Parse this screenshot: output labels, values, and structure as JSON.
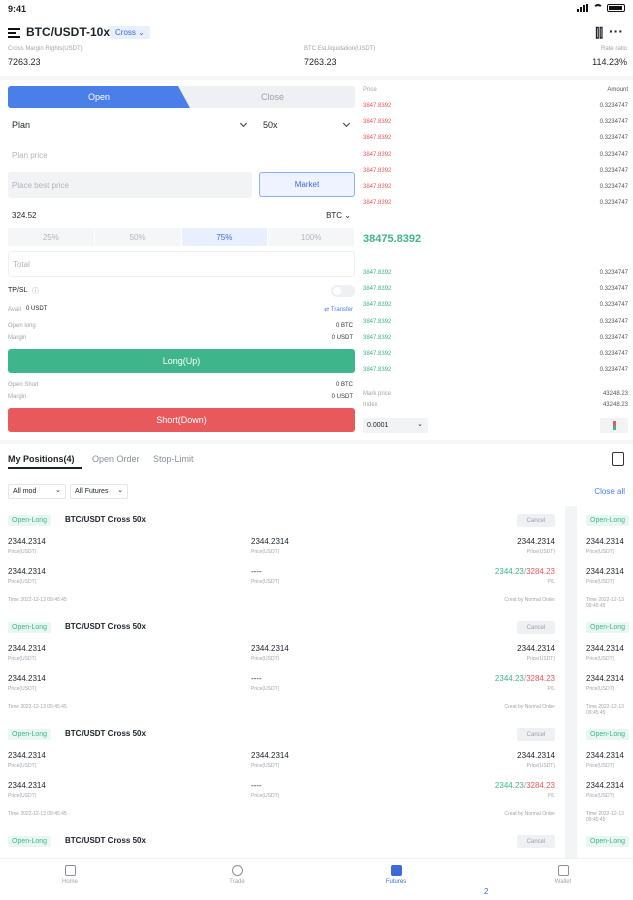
{
  "status": {
    "time": "9:41"
  },
  "header": {
    "pair": "BTC/USDT-10x",
    "mode": "Cross"
  },
  "stats": [
    {
      "label": "Cross Margin Rights(USDT)",
      "value": "7263.23"
    },
    {
      "label": "BTC Est.liquidation(USDT)",
      "value": "7263.23"
    },
    {
      "label": "Rate ratio",
      "value": "114.23%"
    }
  ],
  "form": {
    "tab_open": "Open",
    "tab_close": "Close",
    "order_type": "Plan",
    "leverage": "50x",
    "plan_price_placeholder": "Plan price",
    "best_price_placeholder": "Place best price",
    "market_label": "Market",
    "amount": "324.52",
    "amount_unit": "BTC",
    "percents": [
      "25%",
      "50%",
      "75%",
      "100%"
    ],
    "total_placeholder": "Total",
    "tpsl_label": "TP/SL",
    "avail_label": "Avail",
    "avail_value": "0 USDT",
    "transfer_label": "Transfer",
    "open_long_label": "Open long",
    "open_long_value": "0 BTC",
    "margin_label": "Margin",
    "margin_long_value": "0 USDT",
    "long_button": "Long(Up)",
    "open_short_label": "Open Short",
    "open_short_value": "0 BTC",
    "margin_short_value": "0 USDT",
    "short_button": "Short(Down)"
  },
  "orderbook": {
    "price_header": "Price",
    "amount_header": "Amount",
    "asks": [
      {
        "price": "3847.8392",
        "amount": "0.3234747"
      },
      {
        "price": "3847.8392",
        "amount": "0.3234747"
      },
      {
        "price": "3847.8392",
        "amount": "0.3234747"
      },
      {
        "price": "3847.8392",
        "amount": "0.3234747"
      },
      {
        "price": "3847.8392",
        "amount": "0.3234747"
      },
      {
        "price": "3847.8392",
        "amount": "0.3234747"
      },
      {
        "price": "3847.8392",
        "amount": "0.3234747"
      }
    ],
    "last_price": "38475.8392",
    "bids": [
      {
        "price": "3847.8392",
        "amount": "0.3234747"
      },
      {
        "price": "3847.8392",
        "amount": "0.3234747"
      },
      {
        "price": "3847.8392",
        "amount": "0.3234747"
      },
      {
        "price": "3847.8392",
        "amount": "0.3234747"
      },
      {
        "price": "3847.8392",
        "amount": "0.3234747"
      },
      {
        "price": "3847.8392",
        "amount": "0.3234747"
      },
      {
        "price": "3847.8392",
        "amount": "0.3234747"
      }
    ],
    "mark_label": "Mark price",
    "mark_value": "43248.23",
    "index_label": "Index",
    "index_value": "43248.23",
    "precision": "0.0001"
  },
  "positions": {
    "tabs": [
      "My Positions(4)",
      "Open Order",
      "Stop-Limit"
    ],
    "filter_mode": "All mod",
    "filter_futures": "All Futures",
    "close_all": "Close all",
    "cards": [
      {
        "tag": "Open-Long",
        "title": "BTC/USDT Cross 50x",
        "cancel": "Cancel",
        "v1": "2344.2314",
        "l1": "Price(USDT)",
        "v2": "2344.2314",
        "l2": "Price(USDT)",
        "v3": "2344.2314",
        "l3": "Price(USDT)",
        "v4": "2344.2314",
        "l4": "Price(USDT)",
        "v5": "----",
        "l5": "Price(USDT)",
        "pl_green": "2344.23",
        "pl_red": "3284.23",
        "l6": "P/L",
        "time": "Time 2022-12-13 09:45:45",
        "footer": "Creat by Normal Order"
      },
      {
        "tag": "Open-Long",
        "title": "BTC/USDT Cross 50x",
        "cancel": "Cancel",
        "v1": "2344.2314",
        "l1": "Price(USDT)",
        "v2": "2344.2314",
        "l2": "Price(USDT)",
        "v3": "2344.2314",
        "l3": "Price(USDT)",
        "v4": "2344.2314",
        "l4": "Price(USDT)",
        "v5": "----",
        "l5": "Price(USDT)",
        "pl_green": "2344.23",
        "pl_red": "3284.23",
        "l6": "P/L",
        "time": "Time 2022-12-13 09:45:45",
        "footer": "Creat by Normal Order"
      },
      {
        "tag": "Open-Long",
        "title": "BTC/USDT Cross 50x",
        "cancel": "Cancel",
        "v1": "2344.2314",
        "l1": "Price(USDT)",
        "v2": "2344.2314",
        "l2": "Price(USDT)",
        "v3": "2344.2314",
        "l3": "Price(USDT)",
        "v4": "2344.2314",
        "l4": "Price(USDT)",
        "v5": "----",
        "l5": "Price(USDT)",
        "pl_green": "2344.23",
        "pl_red": "3284.23",
        "l6": "P/L",
        "time": "Time 2022-12-13 09:45:45",
        "footer": "Creat by Normal Order"
      },
      {
        "tag": "Open-Long",
        "title": "BTC/USDT Cross 50x",
        "cancel": "Cancel"
      }
    ]
  },
  "nav": [
    "Home",
    "Trade",
    "Futures",
    "Wallet"
  ],
  "colors": {
    "accent": "#4a7ee8",
    "long": "#3fb58c",
    "short": "#e8595b"
  }
}
